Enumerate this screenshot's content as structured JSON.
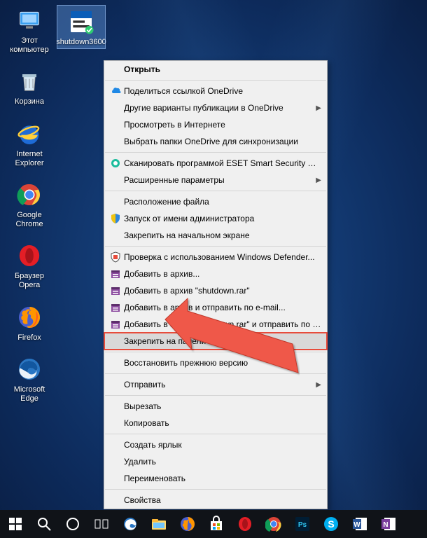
{
  "desktop_icons": [
    {
      "id": "this-pc",
      "label": "Этот компьютер"
    },
    {
      "id": "shutdown",
      "label": "shutdown3600",
      "selected": true
    },
    {
      "id": "recycle",
      "label": "Корзина"
    },
    {
      "id": "ie",
      "label": "Internet Explorer"
    },
    {
      "id": "chrome",
      "label": "Google Chrome"
    },
    {
      "id": "opera",
      "label": "Браузер Opera"
    },
    {
      "id": "firefox",
      "label": "Firefox"
    },
    {
      "id": "edge",
      "label": "Microsoft Edge"
    }
  ],
  "menu": [
    {
      "type": "item",
      "icon": "",
      "label": "Открыть",
      "bold": true
    },
    {
      "type": "sep"
    },
    {
      "type": "item",
      "icon": "onedrive",
      "label": "Поделиться ссылкой OneDrive"
    },
    {
      "type": "item",
      "icon": "",
      "label": "Другие варианты публикации в OneDrive",
      "arrow": true
    },
    {
      "type": "item",
      "icon": "",
      "label": "Просмотреть в Интернете"
    },
    {
      "type": "item",
      "icon": "",
      "label": "Выбрать папки OneDrive для синхронизации"
    },
    {
      "type": "sep"
    },
    {
      "type": "item",
      "icon": "eset",
      "label": "Сканировать программой ESET Smart Security Premium"
    },
    {
      "type": "item",
      "icon": "",
      "label": "Расширенные параметры",
      "arrow": true
    },
    {
      "type": "sep"
    },
    {
      "type": "item",
      "icon": "",
      "label": "Расположение файла"
    },
    {
      "type": "item",
      "icon": "shield",
      "label": "Запуск от имени администратора"
    },
    {
      "type": "item",
      "icon": "",
      "label": "Закрепить на начальном экране"
    },
    {
      "type": "sep"
    },
    {
      "type": "item",
      "icon": "defender",
      "label": "Проверка с использованием Windows Defender..."
    },
    {
      "type": "item",
      "icon": "rar",
      "label": "Добавить в архив..."
    },
    {
      "type": "item",
      "icon": "rar",
      "label": "Добавить в архив \"shutdown.rar\""
    },
    {
      "type": "item",
      "icon": "rar",
      "label": "Добавить в архив и отправить по e-mail..."
    },
    {
      "type": "item",
      "icon": "rar",
      "label": "Добавить в архив \"shutdown.rar\" и отправить по e-mail"
    },
    {
      "type": "item",
      "icon": "",
      "label": "Закрепить на панели задач",
      "hl": true
    },
    {
      "type": "sep"
    },
    {
      "type": "item",
      "icon": "",
      "label": "Восстановить прежнюю версию"
    },
    {
      "type": "sep"
    },
    {
      "type": "item",
      "icon": "",
      "label": "Отправить",
      "arrow": true
    },
    {
      "type": "sep"
    },
    {
      "type": "item",
      "icon": "",
      "label": "Вырезать"
    },
    {
      "type": "item",
      "icon": "",
      "label": "Копировать"
    },
    {
      "type": "sep"
    },
    {
      "type": "item",
      "icon": "",
      "label": "Создать ярлык"
    },
    {
      "type": "item",
      "icon": "",
      "label": "Удалить"
    },
    {
      "type": "item",
      "icon": "",
      "label": "Переименовать"
    },
    {
      "type": "sep"
    },
    {
      "type": "item",
      "icon": "",
      "label": "Свойства"
    }
  ],
  "taskbar": [
    "start",
    "search",
    "cortana",
    "taskview",
    "edge",
    "explorer",
    "firefox",
    "store",
    "opera",
    "chrome",
    "ps",
    "skype",
    "word",
    "onenote"
  ]
}
